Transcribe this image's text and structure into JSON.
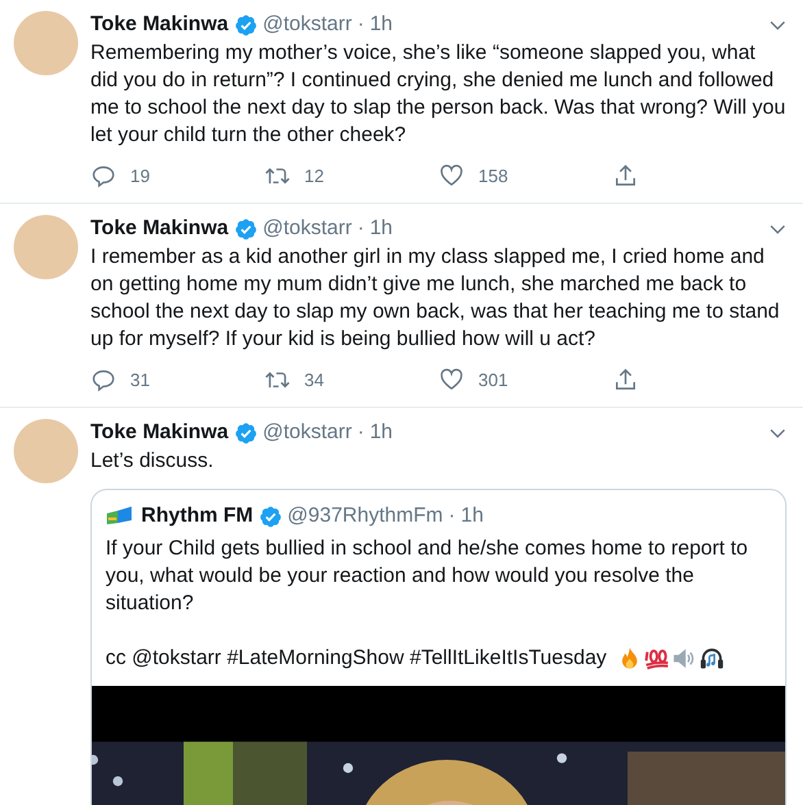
{
  "tweets": [
    {
      "author": "Toke Makinwa",
      "verified": true,
      "handle": "@tokstarr",
      "dot": "·",
      "time": "1h",
      "text": "Remembering my mother’s voice, she’s like “someone slapped you, what did you do in return”? I continued crying, she denied me lunch and followed me to school the next day to slap the person back. Was that wrong? Will you let your child turn the other cheek?",
      "stats": {
        "replies": "19",
        "retweets": "12",
        "likes": "158"
      }
    },
    {
      "author": "Toke Makinwa",
      "verified": true,
      "handle": "@tokstarr",
      "dot": "·",
      "time": "1h",
      "text": "I remember as a kid another girl in my class slapped me, I cried home and on getting home my mum didn’t give me lunch, she marched me back to school the next day to slap my own back, was that her teaching me to stand up for myself? If your kid is being bullied how will u act?",
      "stats": {
        "replies": "31",
        "retweets": "34",
        "likes": "301"
      }
    },
    {
      "author": "Toke Makinwa",
      "verified": true,
      "handle": "@tokstarr",
      "dot": "·",
      "time": "1h",
      "text": "Let’s discuss.",
      "quote": {
        "author": "Rhythm FM",
        "verified": true,
        "handle": "@937RhythmFm",
        "dot": "·",
        "time": "1h",
        "text": "If your Child gets bullied in school and he/she comes home to report to you, what would be your reaction and how would you resolve the situation?",
        "footer": "cc @tokstarr #LateMorningShow #TellItLikeItIsTuesday"
      }
    }
  ]
}
